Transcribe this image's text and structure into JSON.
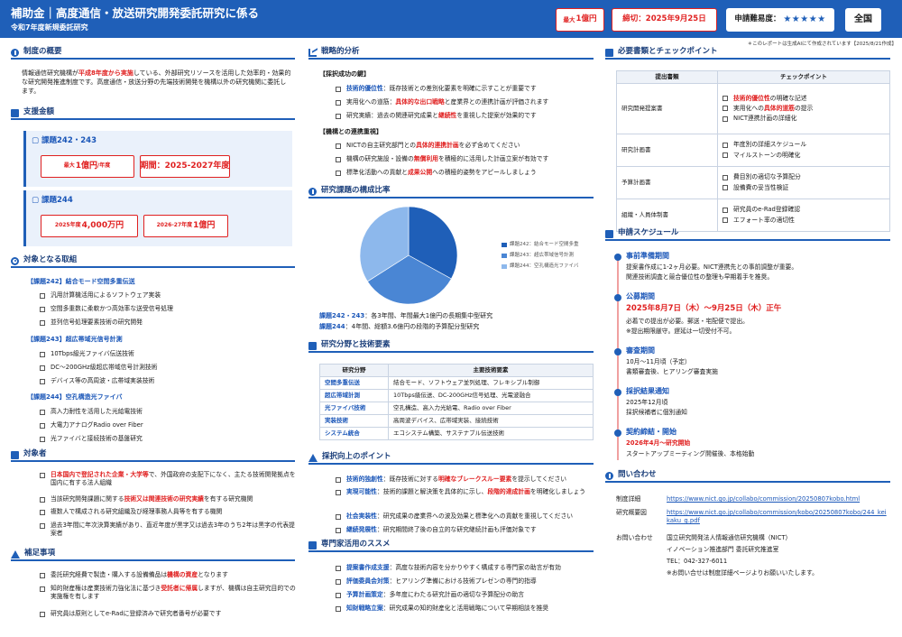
{
  "header": {
    "title": "補助金｜高度通信・放送研究開発委託研究に係る",
    "subtitle": "令和7年度新規委託研究",
    "max_prefix": "最大",
    "max_amount": "1億円",
    "deadline": "締切：2025年9月25日",
    "difficulty_label": "申請難易度：",
    "difficulty_stars": "★★★★★",
    "scope": "全国"
  },
  "note": "＊このレポートは生成AIにて作成されています【2025/8/21作成】",
  "overview": {
    "heading": "制度の概要",
    "p1": "情報通信研究機構が",
    "p1_red": "平成8年度から実施",
    "p1_rest": "している、外部研究リソースを活用した効率的・効果的な研究開発推進制度です。高度通信・放送分野の先端技術開発を機構以外の研究機関に委託します。"
  },
  "support": {
    "heading": "支援金額",
    "box1_title": "課題242・243",
    "box1_max_prefix": "最大",
    "box1_max": "1億円",
    "box1_max_suffix": "/年度",
    "box1_period": "期間：2025-2027年度",
    "box2_title": "課題244",
    "box2_a_prefix": "2025年度",
    "box2_a": "4,000万円",
    "box2_b_prefix": "2026-27年度",
    "box2_b": "1億円"
  },
  "targets": {
    "heading": "対象となる取組",
    "groups": [
      {
        "label": "【課題242】結合モード空間多重伝送",
        "items": [
          "汎用計算機活用によるソフトウェア実装",
          "空間多重数に柔軟かつ高効率な送受信号処理",
          "並列信号処理要素技術の研究開発"
        ]
      },
      {
        "label": "【課題243】超広帯域光信号計測",
        "items": [
          "10Tbps級光ファイバ伝送技術",
          "DC〜200GHz級超広帯域信号計測技術",
          "デバイス等の高周波・広帯域実装技術"
        ]
      },
      {
        "label": "【課題244】空孔構造光ファイバ",
        "items": [
          "高入力耐性を活用した光給電技術",
          "大電力アナログRadio over Fiber",
          "光ファイバと接続技術の基盤研究"
        ]
      }
    ]
  },
  "eligible": {
    "heading": "対象者",
    "i1_red": "日本国内で登記された企業・大学等",
    "i1_rest": "で、外国政府の支配下になく、主たる技術開発拠点を国内に有する法人組織",
    "i2_pre": "当該研究開発課題に関する",
    "i2_red": "技術又は関連技術の研究実績",
    "i2_post": "を有する研究機関",
    "i3": "複数人で構成される研究組織及び経理事務人員等を有する機関",
    "i4": "過去3年間に年次決算実績があり、直近年度が黒字又は過去3年のうち2年は黒字の代表提案者"
  },
  "notes": {
    "heading": "補足事項",
    "n1_pre": "委託研究経費で製造・購入する設備備品は",
    "n1_red": "機構の資産",
    "n1_post": "となります",
    "n2_pre": "知的財産権は産業技術力強化法に基づき",
    "n2_red": "受託者に帰属",
    "n2_post": "しますが、機構は自主研究目的での実施権を有します",
    "n3": "研究員は原則としてe-Radに登録済みで研究者番号が必要です"
  },
  "strategy": {
    "heading": "戦略的分析",
    "g1_label": "【採択成功の鍵】",
    "g1_items": [
      {
        "pre": "",
        "blue": "技術的優位性",
        "post": "：既存技術との差別化要素を明確に示すことが重要です"
      },
      {
        "pre": "実用化への道筋：",
        "red": "具体的な出口戦略",
        "post": "と産業界との連携計画が評価されます"
      },
      {
        "pre": "研究実績：過去の関連研究成果と",
        "red": "継続性",
        "post": "を重視した提案が効果的です"
      }
    ],
    "g2_label": "【機構との連携重視】",
    "g2_items": [
      {
        "pre": "NICTの自主研究部門との",
        "red": "具体的連携計画",
        "post": "を必ず含めてください"
      },
      {
        "pre": "機構の研究施設・設備の",
        "red": "無償利用",
        "post": "を積極的に活用した計画立案が有効です"
      },
      {
        "pre": "標準化活動への貢献と",
        "red": "成果公開",
        "post": "への積極的姿勢をアピールしましょう"
      }
    ]
  },
  "composition": {
    "heading": "研究課題の構成比率",
    "legend": [
      "課題242：結合モード空間多重",
      "課題243：超広帯域信号計測",
      "課題244：空孔構造光ファイバ"
    ],
    "desc1_label": "課題242・243",
    "desc1": "：各3年間、年間最大1億円の長期集中型研究",
    "desc2_label": "課題244",
    "desc2": "：4年間、総額3.6億円の段階的予算配分型研究"
  },
  "chart_data": {
    "type": "pie",
    "categories": [
      "課題242：結合モード空間多重",
      "課題243：超広帯域信号計測",
      "課題244：空孔構造光ファイバ"
    ],
    "values": [
      33,
      33,
      34
    ],
    "colors": [
      "#1f5fb8",
      "#4a86d4",
      "#8db8ec"
    ]
  },
  "tech": {
    "heading": "研究分野と技術要素",
    "col1": "研究分野",
    "col2": "主要技術要素",
    "rows": [
      [
        "空間多重伝送",
        "結合モード、ソフトウェア並列処理、フレキシブル制御"
      ],
      [
        "超広帯域計測",
        "10Tbps級伝送、DC-200GHz信号処理、光電波融合"
      ],
      [
        "光ファイバ技術",
        "空孔構造、高入力光給電、Radio over Fiber"
      ],
      [
        "実装技術",
        "高周波デバイス、広帯域実装、接続技術"
      ],
      [
        "システム統合",
        "エコシステム構築、サステナブル伝送技術"
      ]
    ]
  },
  "points": {
    "heading": "採択向上のポイント",
    "items": [
      {
        "label": "技術的独創性",
        "pre": "：既存技術に対する",
        "red": "明確なブレークスルー要素",
        "post": "を提示してください"
      },
      {
        "label": "実現可能性",
        "pre": "：技術的課題と解決策を具体的に示し、",
        "red": "段階的達成計画",
        "post": "を明確化しましょう"
      },
      {
        "label": "社会実装性",
        "pre": "：研究成果の産業界への波及効果と標準化への貢献を重視してください",
        "red": "",
        "post": ""
      },
      {
        "label": "継続発展性",
        "pre": "：研究期間終了後の自立的な研究継続計画も評価対象です",
        "red": "",
        "post": ""
      }
    ]
  },
  "experts": {
    "heading": "専門家活用のススメ",
    "items": [
      {
        "label": "提案書作成支援",
        "text": "：高度な技術内容を分かりやすく構成する専門家の助言が有効"
      },
      {
        "label": "評価委員会対策",
        "text": "：ヒアリング準備における技術プレゼンの専門的指導"
      },
      {
        "label": "予算計画策定",
        "text": "：多年度にわたる研究計画の適切な予算配分の助言"
      },
      {
        "label": "知財戦略立案",
        "text": "：研究成果の知的財産化と活用戦略について早期相談を推奨"
      }
    ]
  },
  "docs": {
    "heading": "必要書類とチェックポイント",
    "col1": "提出書類",
    "col2": "チェックポイント",
    "rows": [
      {
        "doc": "研究開発提案書",
        "checks": [
          {
            "red": "技術的優位性",
            "post": "の明確な記述"
          },
          {
            "pre": "実用化への",
            "red": "具体的道筋",
            "post": "の提示"
          },
          {
            "pre": "NICT連携計画の詳細化"
          }
        ]
      },
      {
        "doc": "研究計画書",
        "checks": [
          {
            "pre": "年度別の詳細スケジュール"
          },
          {
            "pre": "マイルストーンの明確化"
          }
        ]
      },
      {
        "doc": "予算計画書",
        "checks": [
          {
            "pre": "費目別の適切な予算配分"
          },
          {
            "pre": "設備費の妥当性検証"
          }
        ]
      },
      {
        "doc": "組織・人員体制書",
        "checks": [
          {
            "pre": "研究員のe-Rad登録確認"
          },
          {
            "pre": "エフォート率の適切性"
          }
        ]
      }
    ]
  },
  "schedule": {
    "heading": "申請スケジュール",
    "items": [
      {
        "title": "事前準備期間",
        "lines": [
          "提案書作成に1-2ヶ月必要。NICT連携先との事前調整が重要。",
          "関連技術調査と競合優位性の整理も早期着手を推奨。"
        ]
      },
      {
        "title": "公募期間",
        "date": "2025年8月7日（木）〜9月25日（木）正午",
        "lines": [
          "必着での提出が必要。郵送・宅配便で提出。",
          "※提出期限厳守。遅延は一切受付不可。"
        ]
      },
      {
        "title": "審査期間",
        "lines": [
          "10月〜11月頃（予定）",
          "書類審査後、ヒアリング審査実施"
        ]
      },
      {
        "title": "採択結果通知",
        "lines": [
          "2025年12月頃",
          "採択候補者に個別通知"
        ]
      },
      {
        "title": "契約締結・開始",
        "date": "2026年4月〜研究開始",
        "lines": [
          "スタートアップミーティング開催後、本格始動"
        ]
      }
    ]
  },
  "contact": {
    "heading": "問い合わせ",
    "rows": [
      {
        "label": "制度詳細",
        "value": "https://www.nict.go.jp/collabo/commission/20250807kobo.html",
        "link": true
      },
      {
        "label": "研究概要図",
        "value": "https://www.nict.go.jp/collabo/commission/kobo/20250807kobo/244_keikaku_g.pdf",
        "link": true
      },
      {
        "label": "お問い合わせ",
        "value": "国立研究開発法人情報通信研究機構（NICT）",
        "link": false
      }
    ],
    "extra": [
      "イノベーション推進部門 委託研究推進室",
      "TEL：042-327-6011",
      "※お問い合せは制度詳細ページよりお願いいたします。"
    ]
  }
}
